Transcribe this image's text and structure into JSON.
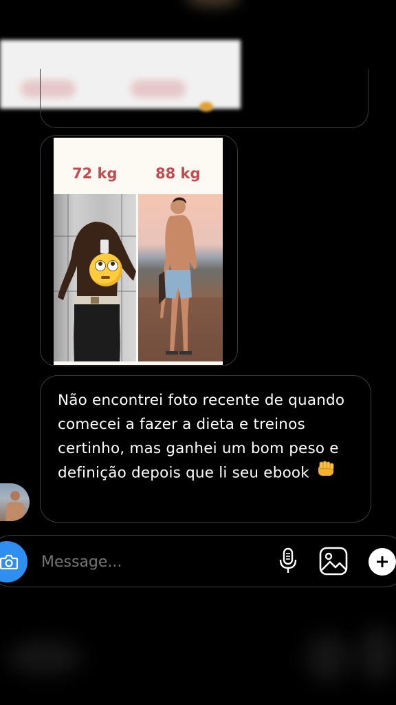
{
  "conversation": {
    "photo_message": {
      "left_label": "72 kg",
      "right_label": "88 kg"
    },
    "text_message": {
      "text": "Não encontrei foto recente de quando comecei a fazer a dieta e treinos certinho, mas ganhei um bom peso e definição depois que li seu ebook",
      "emoji": "oncoming-fist"
    }
  },
  "composer": {
    "placeholder": "Message...",
    "icons": {
      "camera": "camera-icon",
      "mic": "microphone-icon",
      "gallery": "image-icon",
      "plus": "plus-icon"
    }
  },
  "colors": {
    "background": "#000000",
    "bubble_border": "#3b3b3b",
    "weight_label": "#c24a50",
    "camera_button": "#2e8ff0",
    "placeholder": "#9a9a9a"
  }
}
